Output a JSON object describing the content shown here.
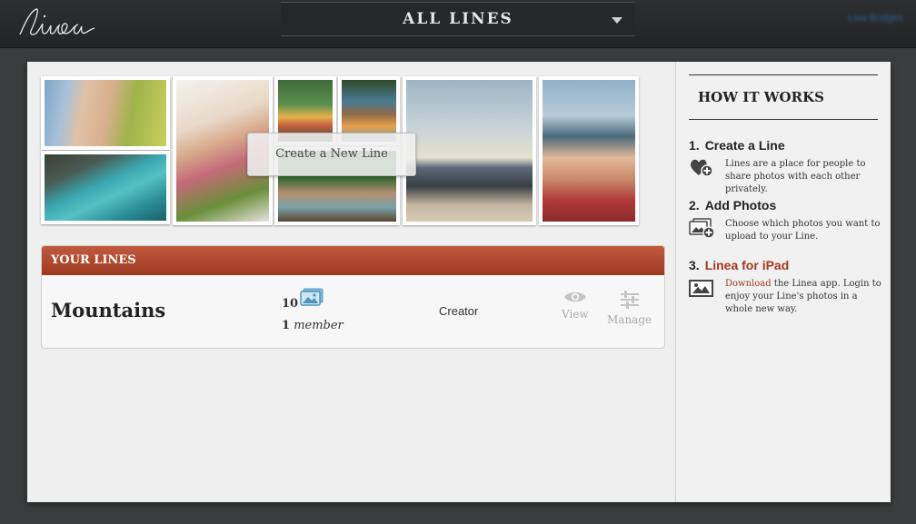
{
  "header": {
    "logo_text": "linea",
    "switcher_label": "ALL LINES",
    "user_link": "Lisa Bridges"
  },
  "collage": {
    "create_button_label": "Create a New Line"
  },
  "your_lines": {
    "heading": "YOUR LINES",
    "rows": [
      {
        "name": "Mountains",
        "photo_count": "10",
        "member_count": "1",
        "member_label": "member",
        "role": "Creator",
        "view_label": "View",
        "manage_label": "Manage"
      }
    ]
  },
  "how_it_works": {
    "title": "HOW IT WORKS",
    "steps": [
      {
        "num": "1.",
        "title": "Create a Line",
        "icon": "heart-plus-icon",
        "desc": "Lines are a place for people to share photos with each other privately."
      },
      {
        "num": "2.",
        "title": "Add Photos",
        "icon": "photos-plus-icon",
        "desc": "Choose which photos you want to upload to your Line."
      },
      {
        "num": "3.",
        "title": "Linea for iPad",
        "icon": "image-icon",
        "link": "Download",
        "desc": " the Linea app. Login to enjoy your Line's photos in a whole new way."
      }
    ]
  },
  "colors": {
    "accent": "#a2391f",
    "header_bar": "#b04a2f",
    "background": "#3b3c3d"
  }
}
